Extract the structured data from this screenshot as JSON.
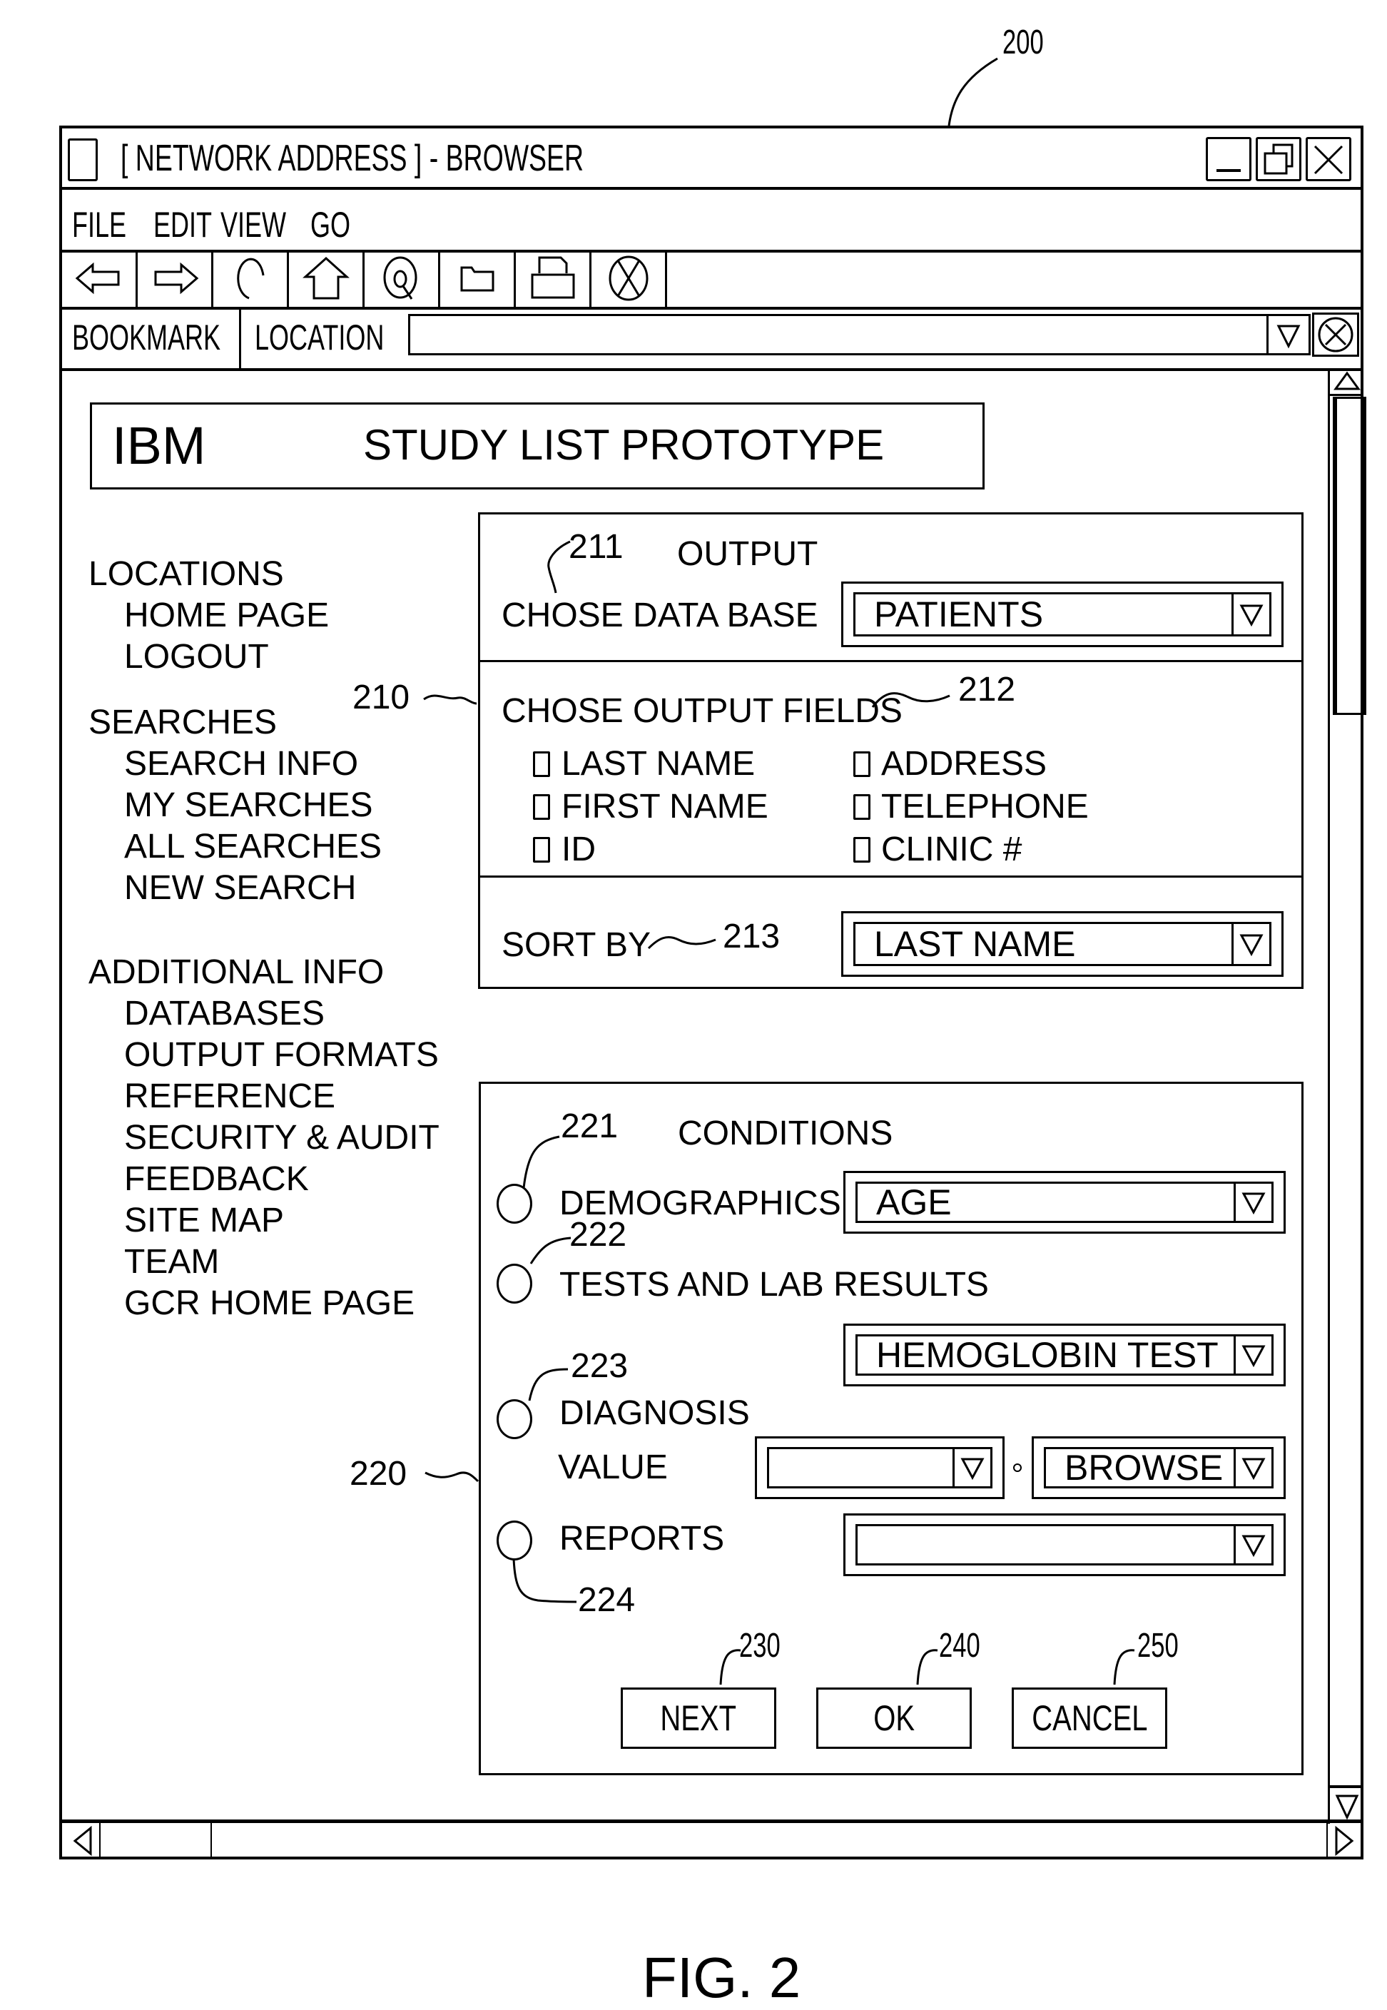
{
  "figure": {
    "ref": "200",
    "caption": "FIG. 2"
  },
  "window": {
    "title": "[ NETWORK ADDRESS ] - BROWSER",
    "controls": [
      "minimize-icon",
      "restore-icon",
      "close-icon"
    ]
  },
  "menu": {
    "items": [
      "FILE",
      "EDIT",
      "VIEW",
      "GO"
    ]
  },
  "toolbar": {
    "buttons": [
      "back-arrow-icon",
      "forward-arrow-icon",
      "reload-icon",
      "home-icon",
      "search-icon",
      "folder-icon",
      "print-icon",
      "stop-icon"
    ]
  },
  "location_bar": {
    "bookmark_label": "BOOKMARK",
    "location_label": "LOCATION",
    "value": ""
  },
  "header": {
    "logo": "IBM",
    "title": "STUDY LIST PROTOTYPE"
  },
  "sidebar": {
    "sections": [
      {
        "heading": "LOCATIONS",
        "items": [
          "HOME PAGE",
          "LOGOUT"
        ]
      },
      {
        "heading": "SEARCHES",
        "items": [
          "SEARCH INFO",
          "MY SEARCHES",
          "ALL SEARCHES",
          "NEW SEARCH"
        ]
      },
      {
        "heading": "ADDITIONAL INFO",
        "items": [
          "DATABASES",
          "OUTPUT FORMATS",
          "REFERENCE",
          "SECURITY & AUDIT",
          "FEEDBACK",
          "SITE MAP",
          "TEAM",
          "GCR HOME PAGE"
        ]
      }
    ]
  },
  "output_panel": {
    "ref": "210",
    "title": "OUTPUT",
    "database": {
      "ref": "211",
      "label": "CHOSE DATA BASE",
      "value": "PATIENTS"
    },
    "fields": {
      "ref": "212",
      "label": "CHOSE OUTPUT FIELDS",
      "options": [
        {
          "label": "LAST NAME",
          "checked": false
        },
        {
          "label": "FIRST NAME",
          "checked": false
        },
        {
          "label": "ID",
          "checked": false
        },
        {
          "label": "ADDRESS",
          "checked": false
        },
        {
          "label": "TELEPHONE",
          "checked": false
        },
        {
          "label": "CLINIC #",
          "checked": false
        }
      ]
    },
    "sort": {
      "ref": "213",
      "label": "SORT BY",
      "value": "LAST NAME"
    }
  },
  "conditions_panel": {
    "ref": "220",
    "title": "CONDITIONS",
    "demographics": {
      "ref": "221",
      "label": "DEMOGRAPHICS",
      "value": "AGE"
    },
    "tests": {
      "ref": "222",
      "label": "TESTS AND LAB RESULTS",
      "value": "HEMOGLOBIN TEST"
    },
    "diagnosis": {
      "ref": "223",
      "label": "DIAGNOSIS",
      "value_label": "VALUE",
      "value": "",
      "browse": "BROWSE"
    },
    "reports": {
      "ref": "224",
      "label": "REPORTS",
      "value": ""
    }
  },
  "actions": {
    "next": {
      "ref": "230",
      "label": "NEXT"
    },
    "ok": {
      "ref": "240",
      "label": "OK"
    },
    "cancel": {
      "ref": "250",
      "label": "CANCEL"
    }
  }
}
